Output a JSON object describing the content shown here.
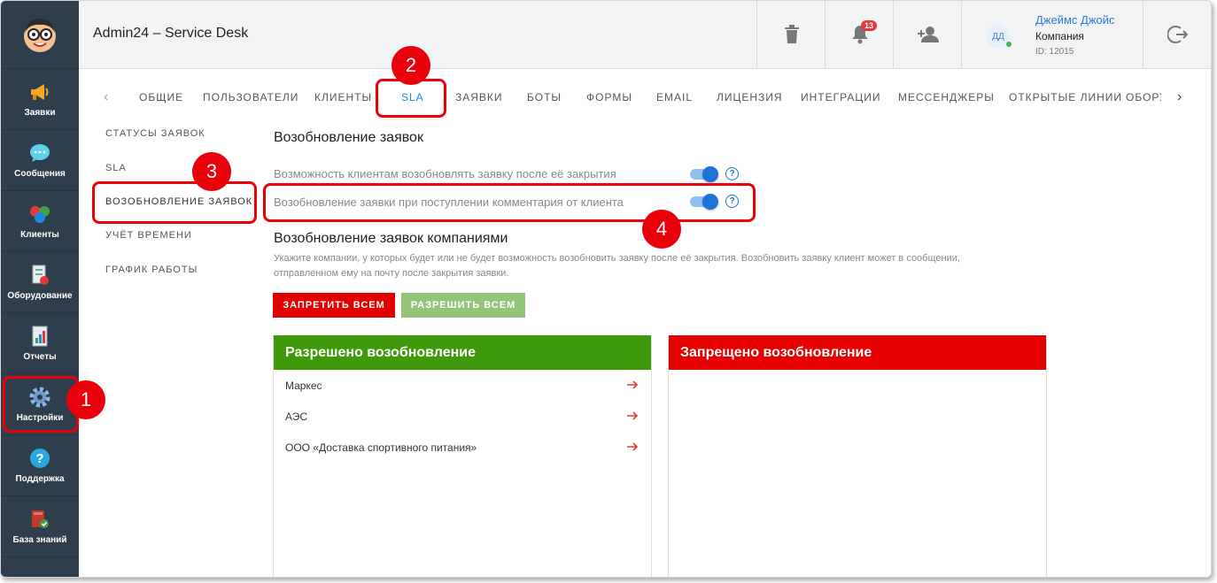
{
  "header": {
    "title": "Admin24 – Service Desk",
    "notifications_count": "13",
    "user": {
      "initials": "ДД",
      "name": "Джеймс Джойс",
      "company": "Компания",
      "id": "ID: 12015"
    }
  },
  "sidebar": {
    "items": [
      {
        "label": "Заявки",
        "icon": "megaphone-icon"
      },
      {
        "label": "Сообщения",
        "icon": "chat-icon"
      },
      {
        "label": "Клиенты",
        "icon": "clients-icon"
      },
      {
        "label": "Оборудование",
        "icon": "equipment-icon"
      },
      {
        "label": "Отчеты",
        "icon": "reports-icon"
      },
      {
        "label": "Настройки",
        "icon": "gear-icon"
      },
      {
        "label": "Поддержка",
        "icon": "help-icon"
      },
      {
        "label": "База знаний",
        "icon": "book-icon"
      }
    ]
  },
  "tabs": [
    "ОБЩИЕ",
    "ПОЛЬЗОВАТЕЛИ",
    "КЛИЕНТЫ",
    "SLA",
    "ЗАЯВКИ",
    "БОТЫ",
    "ФОРМЫ",
    "EMAIL",
    "ЛИЦЕНЗИЯ",
    "ИНТЕГРАЦИИ",
    "МЕССЕНДЖЕРЫ",
    "ОТКРЫТЫЕ ЛИНИИ",
    "ОБОРУДОВАНИЕ"
  ],
  "active_tab": "SLA",
  "subnav": [
    "СТАТУСЫ ЗАЯВОК",
    "SLA",
    "ВОЗОБНОВЛЕНИЕ ЗАЯВОК",
    "УЧЁТ ВРЕМЕНИ",
    "ГРАФИК РАБОТЫ"
  ],
  "content": {
    "title": "Возобновление заявок",
    "options": [
      {
        "label": "Возможность клиентам возобновлять заявку после её закрытия",
        "enabled": true
      },
      {
        "label": "Возобновление заявки при поступлении комментария от клиента",
        "enabled": true
      }
    ],
    "companies_title": "Возобновление заявок компаниями",
    "companies_desc": "Укажите компании, у которых будет или не будет возможность возобновить заявку после её закрытия. Возобновить заявку клиент может в сообщении, отправленном ему на почту после закрытия заявки.",
    "deny_all": "ЗАПРЕТИТЬ ВСЕМ",
    "allow_all": "РАЗРЕШИТЬ ВСЕМ",
    "allowed_panel": {
      "title": "Разрешено возобновление",
      "companies": [
        "Маркес",
        "АЭС",
        "ООО «Доставка спортивного питания»"
      ]
    },
    "denied_panel": {
      "title": "Запрещено возобновление",
      "companies": []
    }
  },
  "callouts": [
    "1",
    "2",
    "3",
    "4"
  ],
  "colors": {
    "sidebar": "#2f3e4d",
    "accent": "#1e88e5",
    "green": "#3e9a0a",
    "red": "#e60000",
    "callout": "#e8000b"
  }
}
